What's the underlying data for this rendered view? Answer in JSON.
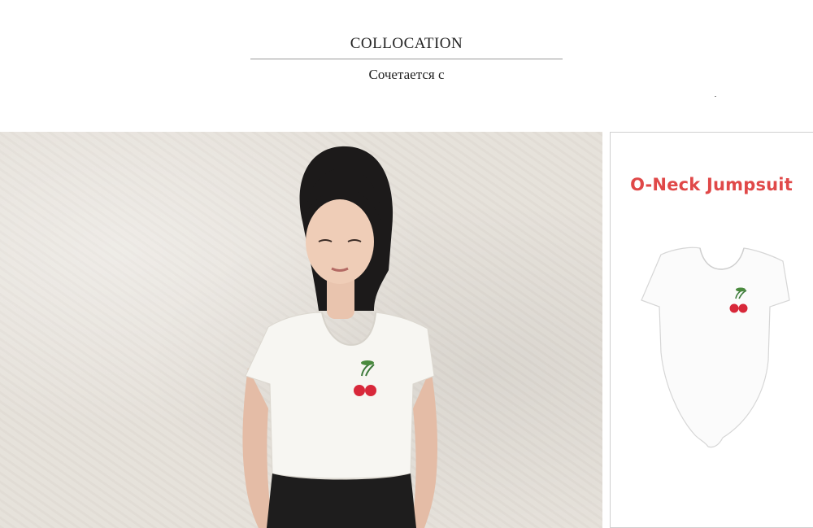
{
  "header": {
    "title": "COLLOCATION",
    "subtitle": "Сочетается с"
  },
  "product_card": {
    "title": "O-Neck Jumpsuit"
  },
  "colors": {
    "accent_title": "#e04848",
    "wall": "#e6e1da",
    "cherry": "#d8283a"
  }
}
